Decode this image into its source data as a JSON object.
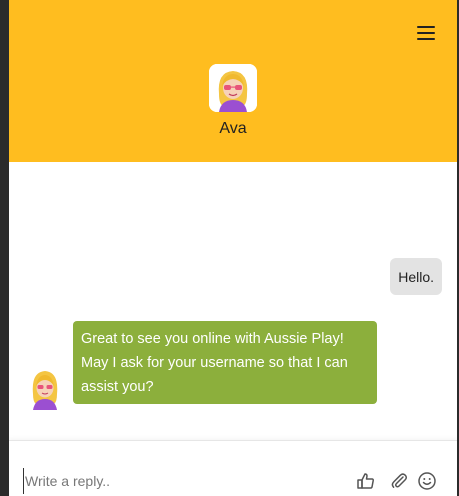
{
  "header": {
    "agent_name": "Ava",
    "menu_icon": "hamburger-menu-icon",
    "background_color": "#ffbd1f"
  },
  "messages": [
    {
      "sender": "user",
      "text": "Hello."
    },
    {
      "sender": "agent",
      "text": "Great to see you online with Aussie Play! May I ask for your username so that I can assist you?"
    }
  ],
  "composer": {
    "placeholder": "Write a reply..",
    "icons": [
      "thumbs-up-icon",
      "paperclip-icon",
      "smiley-icon"
    ]
  },
  "colors": {
    "agent_bubble": "#8caf3c",
    "user_bubble": "#e3e3e3"
  }
}
